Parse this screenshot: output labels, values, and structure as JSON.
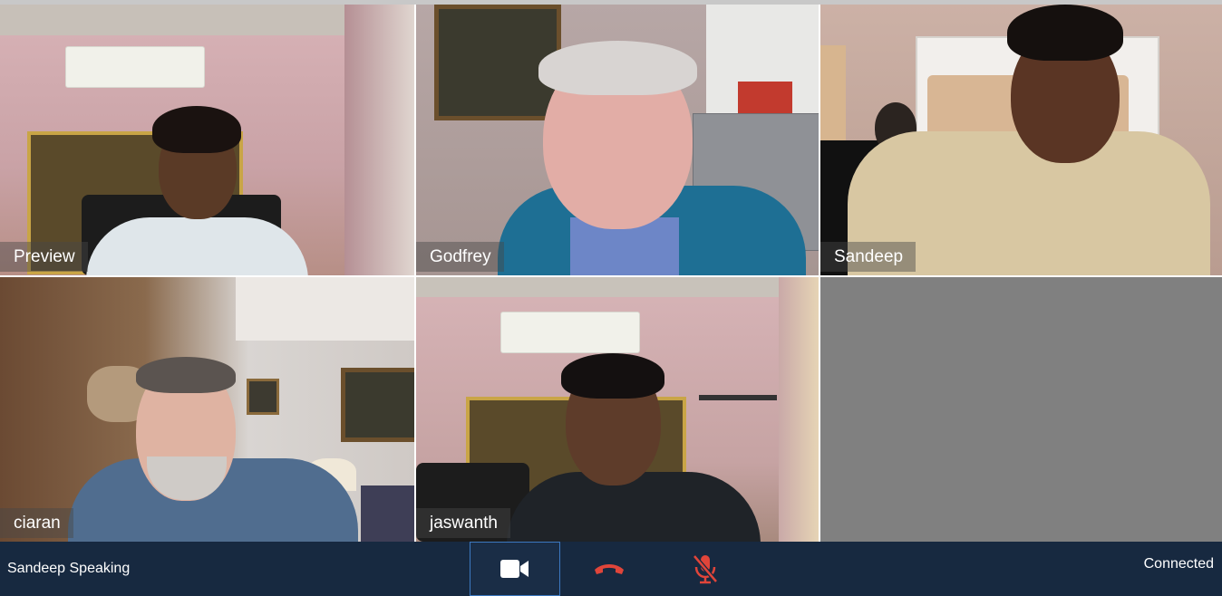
{
  "participants": [
    {
      "name": "Preview"
    },
    {
      "name": "Godfrey"
    },
    {
      "name": "Sandeep"
    },
    {
      "name": "ciaran"
    },
    {
      "name": "jaswanth"
    }
  ],
  "toolbar": {
    "speaking_text": "Sandeep Speaking",
    "status_text": "Connected",
    "video_icon": "video-camera-icon",
    "hangup_icon": "phone-hangup-icon",
    "mic_icon": "microphone-muted-icon"
  },
  "colors": {
    "toolbar_bg": "#172940",
    "hangup_red": "#e0453a",
    "video_border": "#3c78c0",
    "empty_tile": "#808080"
  }
}
